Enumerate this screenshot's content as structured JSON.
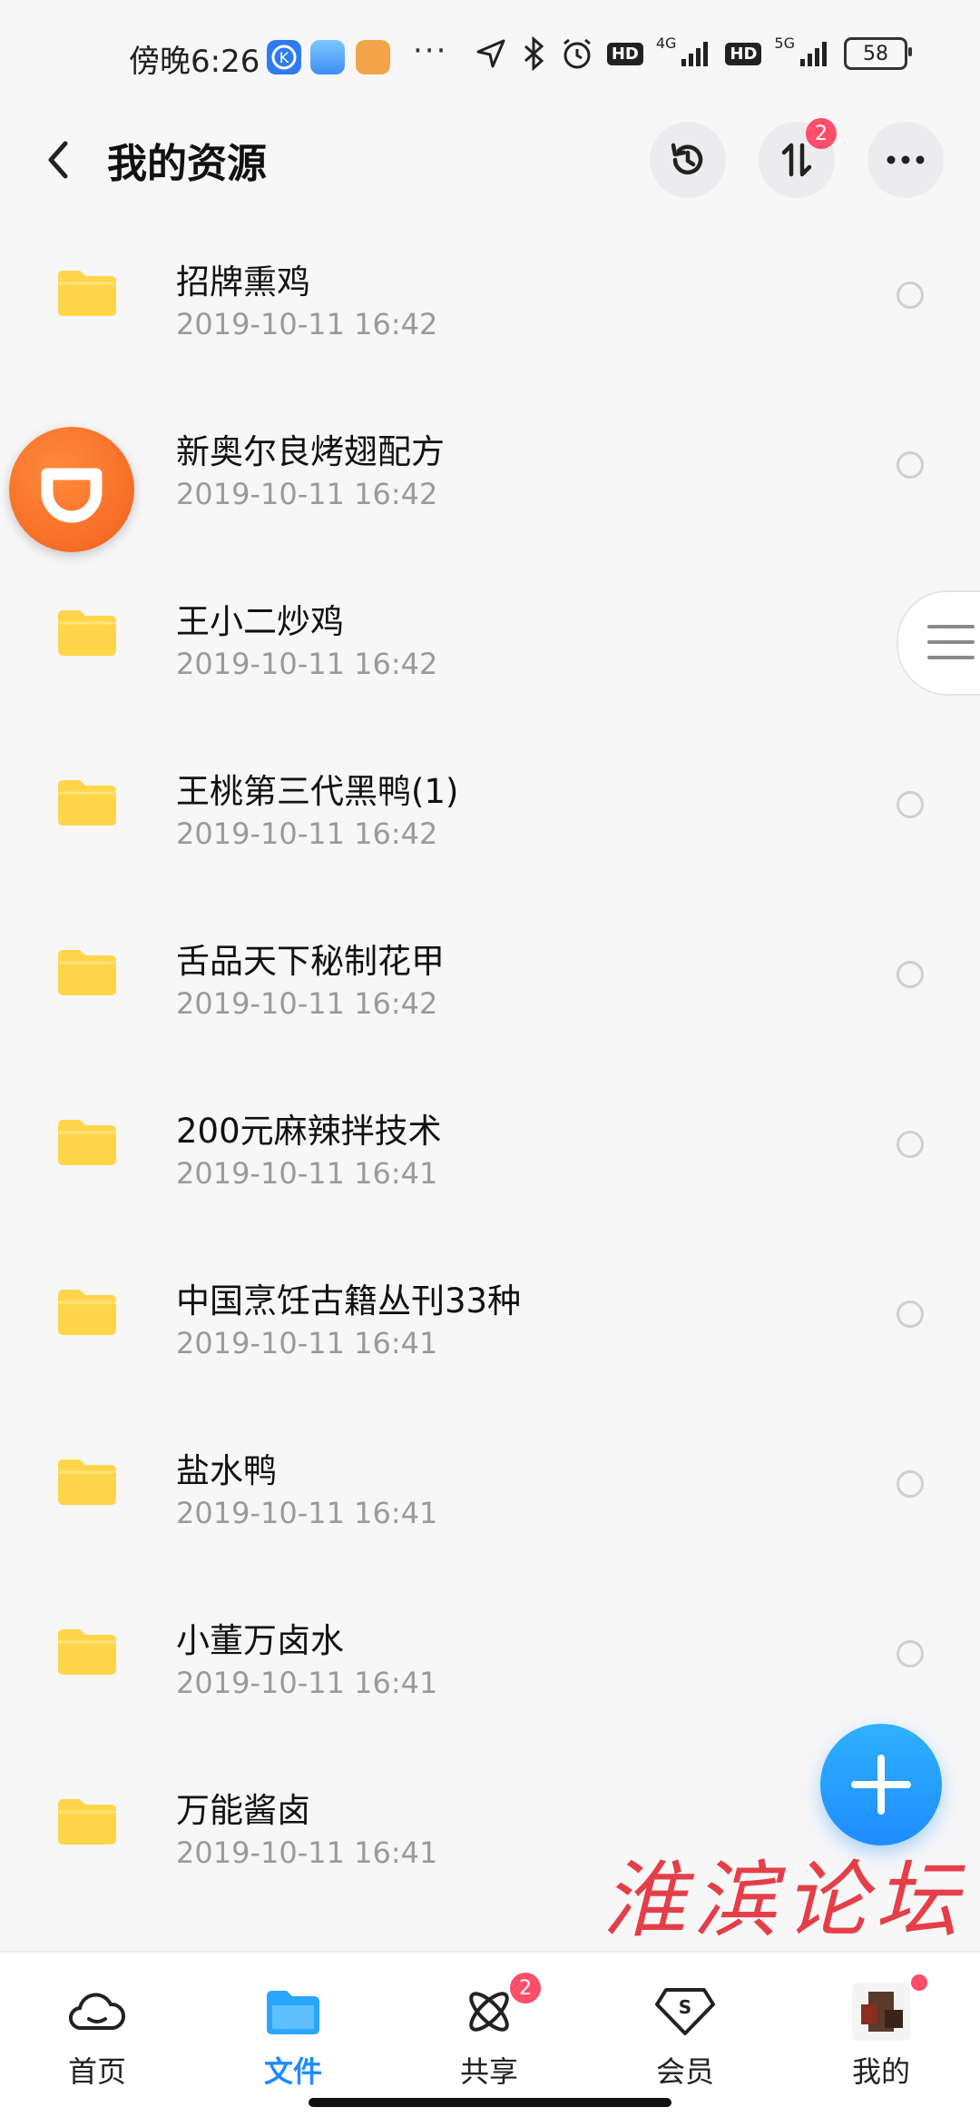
{
  "status_bar": {
    "time": "傍晚6:26",
    "dots": "···",
    "hd1": "HD",
    "net1": "4G",
    "hd2": "HD",
    "net2": "5G",
    "battery": "58"
  },
  "header": {
    "title": "我的资源",
    "transfer_badge": "2"
  },
  "files": [
    {
      "name": "招牌熏鸡",
      "date": "2019-10-11  16:42"
    },
    {
      "name": "新奥尔良烤翅配方",
      "date": "2019-10-11  16:42"
    },
    {
      "name": "王小二炒鸡",
      "date": "2019-10-11  16:42"
    },
    {
      "name": "王桃第三代黑鸭(1)",
      "date": "2019-10-11  16:42"
    },
    {
      "name": "舌品天下秘制花甲",
      "date": "2019-10-11  16:42"
    },
    {
      "name": "200元麻辣拌技术",
      "date": "2019-10-11  16:41"
    },
    {
      "name": "中国烹饪古籍丛刊33种",
      "date": "2019-10-11  16:41"
    },
    {
      "name": "盐水鸭",
      "date": "2019-10-11  16:41"
    },
    {
      "name": "小董万卤水",
      "date": "2019-10-11  16:41"
    },
    {
      "name": "万能酱卤",
      "date": "2019-10-11  16:41"
    }
  ],
  "watermark": "淮滨论坛",
  "bottom_nav": {
    "home": "首页",
    "files": "文件",
    "share": "共享",
    "share_badge": "2",
    "vip": "会员",
    "mine": "我的"
  },
  "colors": {
    "accent": "#1e8cff",
    "folder": "#ffd54a",
    "badge": "#ff4d6a"
  }
}
